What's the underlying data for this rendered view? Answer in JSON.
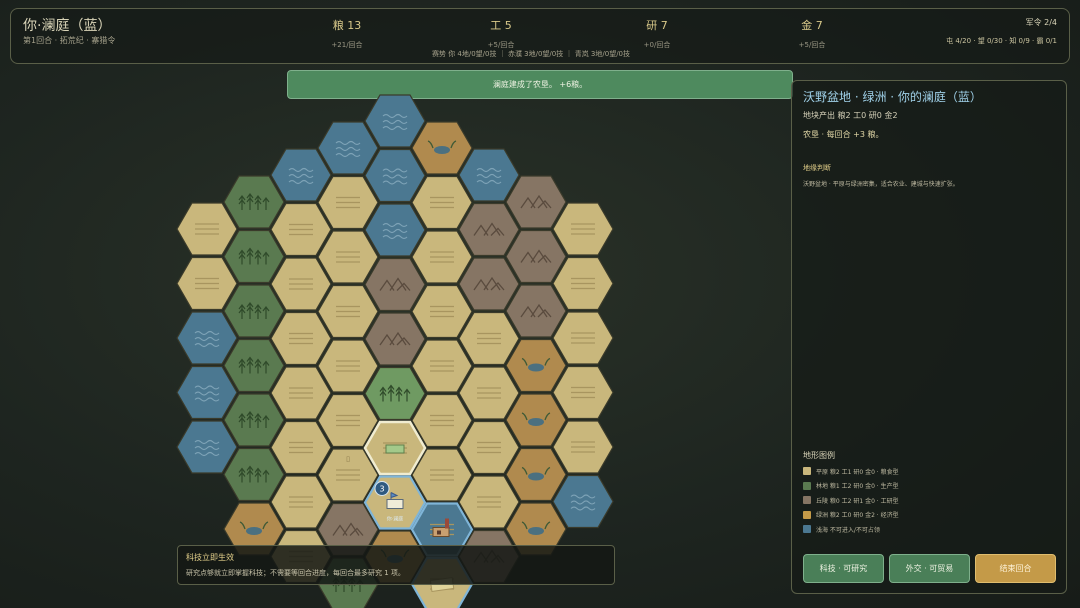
{
  "player": {
    "name": "你·澜庭（蓝）",
    "subtitle": "第1回合 · 拓荒纪 · 寨猎令"
  },
  "resources": [
    {
      "value": "粮 13",
      "rate": "+21/回合"
    },
    {
      "value": "工 5",
      "rate": "+5/回合"
    },
    {
      "value": "研 7",
      "rate": "+0/回合"
    },
    {
      "value": "金 7",
      "rate": "+5/回合"
    }
  ],
  "influence_line": "赛势 你 4地/0望/0技 ｜ 赤濮 3地/0望/0技 ｜ 青岚 3地/0望/0技",
  "army": "军令 2/4",
  "counts": "屯 4/20 · 望 0/30 · 知 0/9 · 霸 0/1",
  "toast": "澜庭建成了农垦。 +6粮。",
  "map": {
    "unit_count": "3",
    "unit_label": "你·澜庭",
    "terrain_colors": {
      "plains": "#c9b77c",
      "forest": "#5a7a50",
      "hills": "#867564",
      "oasis": "#b08a4e",
      "shallows": "#4b7891",
      "grass": "#6f9a62"
    }
  },
  "tech_tip": {
    "title": "科技立即生效",
    "text": "研究点够就立即掌握科技；不需要等回合进度，每回合最多研究 1 项。"
  },
  "side": {
    "title": "沃野盆地 · 绿洲 · 你的澜庭（蓝）",
    "yield": "地块产出  粮2  工0  研0  金2",
    "farm": "农垦 · 每回合 +3 粮。",
    "judgement_heading": "地缘判断",
    "judgement_text": "沃野盆地 · 平原与绿洲密集，适合农业、建城与快速扩张。",
    "legend_heading": "地形图例",
    "legend": [
      {
        "color": "#c9b77c",
        "text": "平原  粮2 工1 研0 金0 · 粮食型"
      },
      {
        "color": "#5a7a50",
        "text": "林地  粮1 工2 研0 金0 · 生产型"
      },
      {
        "color": "#867564",
        "text": "丘陵  粮0 工2 研1 金0 · 工研型"
      },
      {
        "color": "#c49a48",
        "text": "绿洲  粮2 工0 研0 金2 · 经济型"
      },
      {
        "color": "#4b7891",
        "text": "浅海  不可进入/不可占领"
      }
    ],
    "buttons": {
      "research": "科技 · 可研究",
      "diplomacy": "外交 · 可贸易",
      "end_turn": "结束回合"
    }
  }
}
